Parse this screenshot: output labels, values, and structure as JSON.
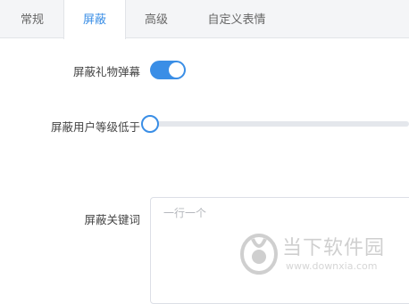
{
  "tabs": [
    {
      "label": "常规",
      "active": false
    },
    {
      "label": "屏蔽",
      "active": true
    },
    {
      "label": "高级",
      "active": false
    },
    {
      "label": "自定义表情",
      "active": false
    }
  ],
  "settings": {
    "gift_danmaku": {
      "label": "屏蔽礼物弹幕",
      "enabled": true
    },
    "user_level": {
      "label": "屏蔽用户等级低于",
      "value_fraction": 0
    },
    "keywords": {
      "label": "屏蔽关键词",
      "placeholder": "一行一个",
      "value": ""
    }
  },
  "watermark": {
    "icon": "downxia-logo-icon",
    "title": "当下软件园",
    "url": "www.downxia.com"
  },
  "colors": {
    "accent": "#3a8ee6",
    "tabbar_bg": "#f4f5f7",
    "track": "#e4e7ec"
  }
}
